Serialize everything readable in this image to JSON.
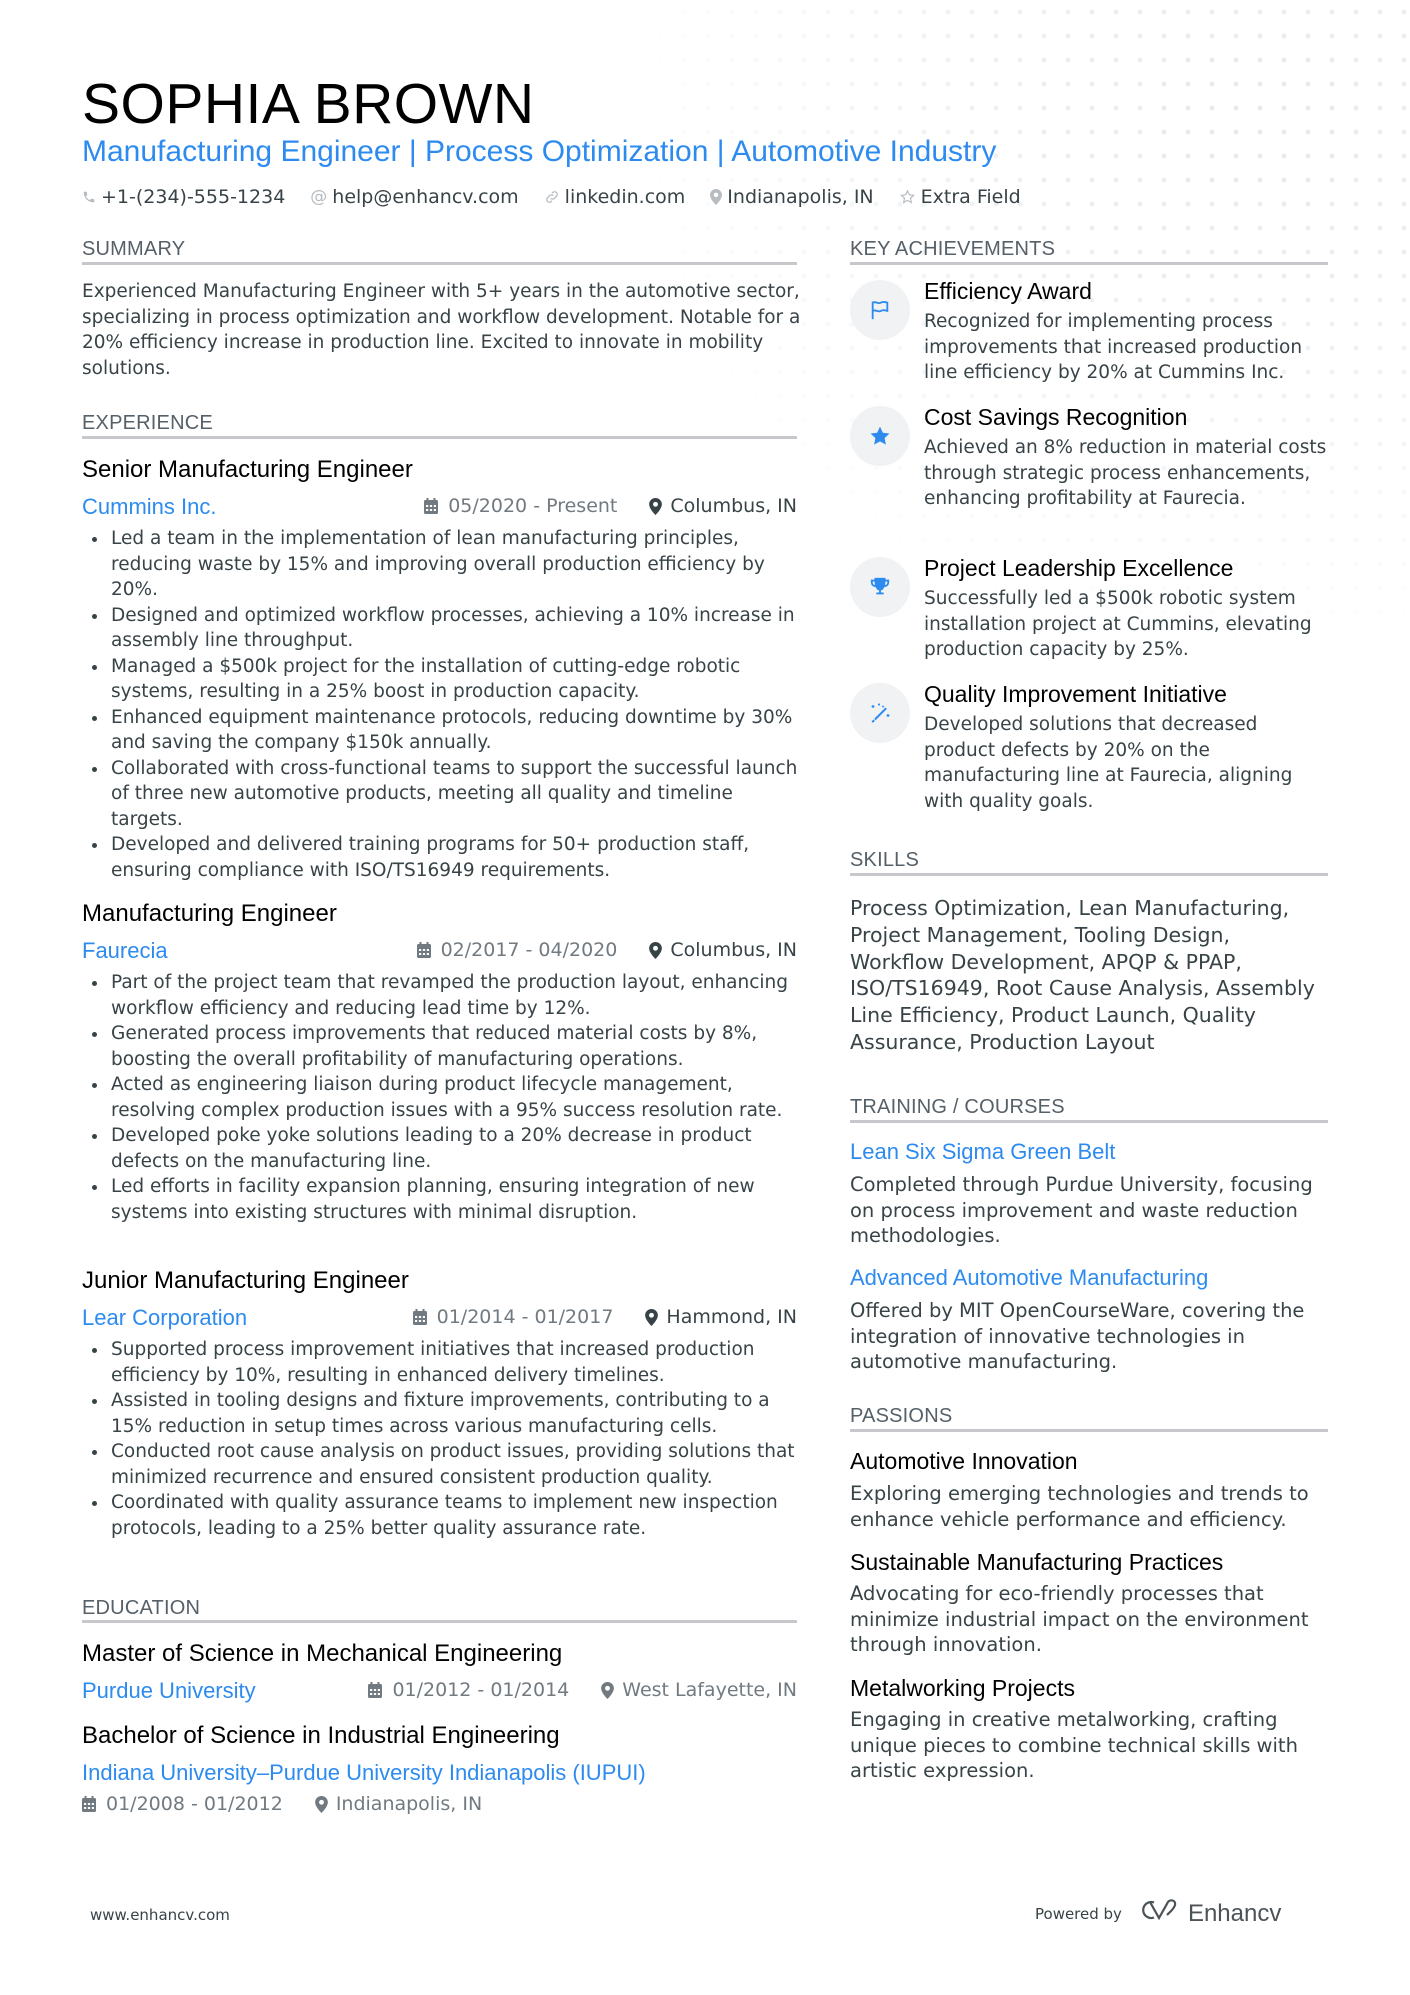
{
  "header": {
    "name": "SOPHIA BROWN",
    "title": "Manufacturing Engineer | Process Optimization | Automotive Industry",
    "contacts": [
      {
        "icon": "phone-icon",
        "text": "+1-(234)-555-1234"
      },
      {
        "icon": "at-icon",
        "text": "help@enhancv.com"
      },
      {
        "icon": "link-icon",
        "text": "linkedin.com"
      },
      {
        "icon": "location-pin-icon",
        "text": "Indianapolis, IN"
      },
      {
        "icon": "star-outline-icon",
        "text": "Extra Field"
      }
    ]
  },
  "summary": {
    "heading": "SUMMARY",
    "text": "Experienced Manufacturing Engineer with 5+ years in the automotive sector, specializing in process optimization and workflow development. Notable for a 20% efficiency increase in production line. Excited to innovate in mobility solutions."
  },
  "experience": {
    "heading": "EXPERIENCE",
    "items": [
      {
        "role": "Senior Manufacturing Engineer",
        "company": "Cummins Inc.",
        "dates": "05/2020 - Present",
        "location": "Columbus, IN",
        "bullets": [
          "Led a team in the implementation of lean manufacturing principles, reducing waste by 15% and improving overall production efficiency by 20%.",
          "Designed and optimized workflow processes, achieving a 10% increase in assembly line throughput.",
          "Managed a $500k project for the installation of cutting-edge robotic systems, resulting in a 25% boost in production capacity.",
          "Enhanced equipment maintenance protocols, reducing downtime by 30% and saving the company $150k annually.",
          "Collaborated with cross-functional teams to support the successful launch of three new automotive products, meeting all quality and timeline targets.",
          "Developed and delivered training programs for 50+ production staff, ensuring compliance with ISO/TS16949 requirements."
        ]
      },
      {
        "role": "Manufacturing Engineer",
        "company": "Faurecia",
        "dates": "02/2017 - 04/2020",
        "location": "Columbus, IN",
        "bullets": [
          "Part of the project team that revamped the production layout, enhancing workflow efficiency and reducing lead time by 12%.",
          "Generated process improvements that reduced material costs by 8%, boosting the overall profitability of manufacturing operations.",
          "Acted as engineering liaison during product lifecycle management, resolving complex production issues with a 95% success resolution rate.",
          "Developed poke yoke solutions leading to a 20% decrease in product defects on the manufacturing line.",
          "Led efforts in facility expansion planning, ensuring integration of new systems into existing structures with minimal disruption."
        ]
      },
      {
        "role": "Junior Manufacturing Engineer",
        "company": "Lear Corporation",
        "dates": "01/2014 - 01/2017",
        "location": "Hammond, IN",
        "bullets": [
          "Supported process improvement initiatives that increased production efficiency by 10%, resulting in enhanced delivery timelines.",
          "Assisted in tooling designs and fixture improvements, contributing to a 15% reduction in setup times across various manufacturing cells.",
          "Conducted root cause analysis on product issues, providing solutions that minimized recurrence and ensured consistent production quality.",
          "Coordinated with quality assurance teams to implement new inspection protocols, leading to a 25% better quality assurance rate."
        ]
      }
    ]
  },
  "education": {
    "heading": "EDUCATION",
    "items": [
      {
        "degree": "Master of Science in Mechanical Engineering",
        "school": "Purdue University",
        "dates": "01/2012 - 01/2014",
        "location": "West Lafayette, IN"
      },
      {
        "degree": "Bachelor of Science in Industrial Engineering",
        "school": "Indiana University–Purdue University Indianapolis (IUPUI)",
        "dates": "01/2008 - 01/2012",
        "location": "Indianapolis, IN"
      }
    ]
  },
  "achievements": {
    "heading": "KEY ACHIEVEMENTS",
    "items": [
      {
        "icon": "flag-icon",
        "title": "Efficiency Award",
        "description": "Recognized for implementing process improvements that increased production line efficiency by 20% at Cummins Inc."
      },
      {
        "icon": "star-icon",
        "title": "Cost Savings Recognition",
        "description": "Achieved an 8% reduction in material costs through strategic process enhancements, enhancing profitability at Faurecia."
      },
      {
        "icon": "trophy-icon",
        "title": "Project Leadership Excellence",
        "description": "Successfully led a $500k robotic system installation project at Cummins, elevating production capacity by 25%."
      },
      {
        "icon": "magic-wand-icon",
        "title": "Quality Improvement Initiative",
        "description": "Developed solutions that decreased product defects by 20% on the manufacturing line at Faurecia, aligning with quality goals."
      }
    ]
  },
  "skills": {
    "heading": "SKILLS",
    "text": "Process Optimization, Lean Manufacturing, Project Management, Tooling Design, Workflow Development, APQP & PPAP, ISO/TS16949, Root Cause Analysis, Assembly Line Efficiency, Product Launch, Quality Assurance, Production Layout"
  },
  "training": {
    "heading": "TRAINING / COURSES",
    "items": [
      {
        "title": "Lean Six Sigma Green Belt",
        "description": "Completed through Purdue University, focusing on process improvement and waste reduction methodologies."
      },
      {
        "title": "Advanced Automotive Manufacturing",
        "description": "Offered by MIT OpenCourseWare, covering the integration of innovative technologies in automotive manufacturing."
      }
    ]
  },
  "passions": {
    "heading": "PASSIONS",
    "items": [
      {
        "title": "Automotive Innovation",
        "description": "Exploring emerging technologies and trends to enhance vehicle performance and efficiency."
      },
      {
        "title": "Sustainable Manufacturing Practices",
        "description": "Advocating for eco-friendly processes that minimize industrial impact on the environment through innovation."
      },
      {
        "title": "Metalworking Projects",
        "description": "Engaging in creative metalworking, crafting unique pieces to combine technical skills with artistic expression."
      }
    ]
  },
  "footer": {
    "website": "www.enhancv.com",
    "powered_by": "Powered by",
    "brand": "Enhancv"
  },
  "colors": {
    "accent": "#2d8bf0",
    "text": "#384347",
    "muted": "#717a80",
    "rule": "#c6c8cb",
    "icon_bg": "#f1f2f3"
  }
}
